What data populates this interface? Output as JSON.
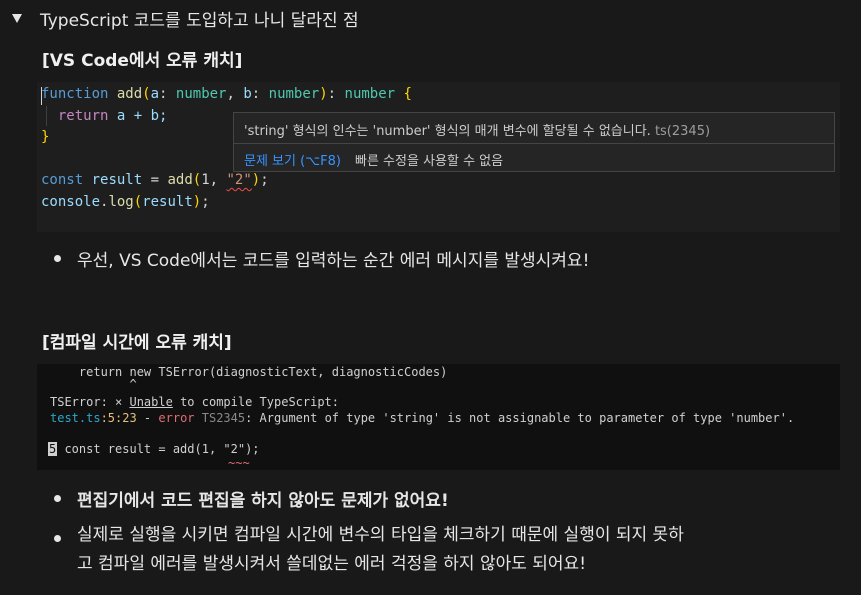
{
  "toggle": {
    "title": "TypeScript 코드를 도입하고 나니 달라진 점"
  },
  "section1": {
    "heading": "[VS Code에서 오류 캐치]"
  },
  "code_editor": {
    "line1": {
      "kw": "function",
      "fn": "add",
      "p1": "a",
      "p2": "b",
      "t1": "number",
      "t2": "number",
      "t3": "number"
    },
    "line2": {
      "kw": "return",
      "expr": "a + b;"
    },
    "line3": "}",
    "line5": {
      "kw": "const",
      "var": "result",
      "fn": "add",
      "num": "1",
      "str": "\"2\""
    },
    "line6": {
      "obj": "console",
      "fn": "log",
      "arg": "result"
    }
  },
  "hover": {
    "message": "'string' 형식의 인수는 'number' 형식의 매개 변수에 할당될 수 없습니다.",
    "code": "ts(2345)",
    "view_problem": "문제 보기 (⌥F8)",
    "no_quick_fix": "빠른 수정을 사용할 수 없음"
  },
  "bullet1": "우선, VS Code에서는 코드를 입력하는 순간 에러 메시지를 발생시켜요!",
  "section2": {
    "heading": "[컴파일 시간에 오류 캐치]"
  },
  "terminal": {
    "line1": "    return new TSError(diagnosticText, diagnosticCodes)",
    "line2": "           ^",
    "line3_pre": "TSError: × ",
    "line3_u": "Unable",
    "line3_post": " to compile TypeScript:",
    "file": "test.ts",
    "pos": ":5:23",
    "dash": " - ",
    "error": "error",
    "code": " TS2345",
    "msg": ": Argument of type 'string' is not assignable to parameter of type 'number'.",
    "lineno": "5",
    "src": " const result = add(1, \"2\");",
    "squiggle": "~~~"
  },
  "bullet2": "편집기에서 코드 편집을 하지 않아도 문제가 없어요!",
  "bullet3_l1": "실제로 실행을 시키면 컴파일 시간에 변수의 타입을 체크하기 때문에 실행이 되지 못하",
  "bullet3_l2": "고 컴파일 에러를 발생시켜서 쓸데없는 에러 걱정을 하지 않아도 되어요!"
}
